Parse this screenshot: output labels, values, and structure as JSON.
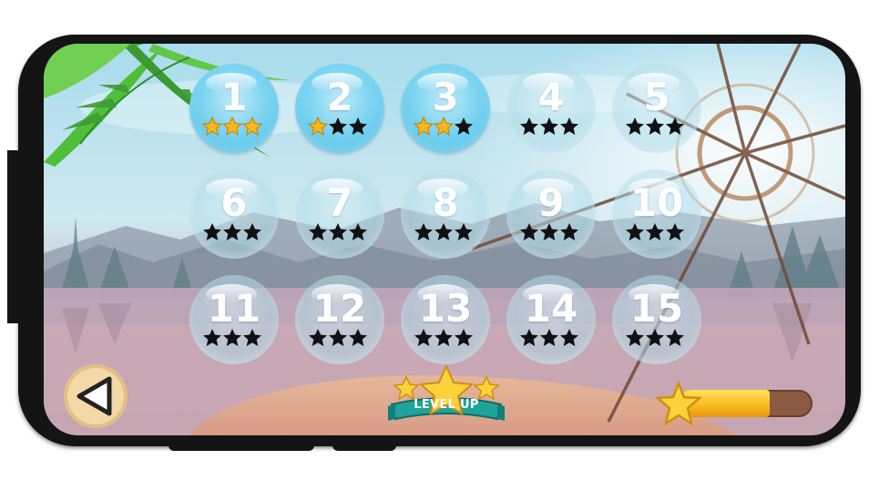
{
  "levels": [
    {
      "number": "1",
      "stars": 3,
      "unlocked": true
    },
    {
      "number": "2",
      "stars": 1,
      "unlocked": true
    },
    {
      "number": "3",
      "stars": 2,
      "unlocked": true
    },
    {
      "number": "4",
      "stars": 0,
      "unlocked": false
    },
    {
      "number": "5",
      "stars": 0,
      "unlocked": false
    },
    {
      "number": "6",
      "stars": 0,
      "unlocked": false
    },
    {
      "number": "7",
      "stars": 0,
      "unlocked": false
    },
    {
      "number": "8",
      "stars": 0,
      "unlocked": false
    },
    {
      "number": "9",
      "stars": 0,
      "unlocked": false
    },
    {
      "number": "10",
      "stars": 0,
      "unlocked": false
    },
    {
      "number": "11",
      "stars": 0,
      "unlocked": false
    },
    {
      "number": "12",
      "stars": 0,
      "unlocked": false
    },
    {
      "number": "13",
      "stars": 0,
      "unlocked": false
    },
    {
      "number": "14",
      "stars": 0,
      "unlocked": false
    },
    {
      "number": "15",
      "stars": 0,
      "unlocked": false
    }
  ],
  "level_up": {
    "label": "LEVEL UP"
  },
  "back_button": {
    "icon": "triangle-left-icon"
  },
  "progress": {
    "fraction": 0.68,
    "icon": "star-icon"
  },
  "colors": {
    "star_earned": "#f6b81a",
    "star_empty": "#111111",
    "bubble_unlocked": "#3eb7e3",
    "ribbon": "#1fa39a",
    "progress_fill": "#f8b81e",
    "progress_track": "#8a5a42"
  }
}
